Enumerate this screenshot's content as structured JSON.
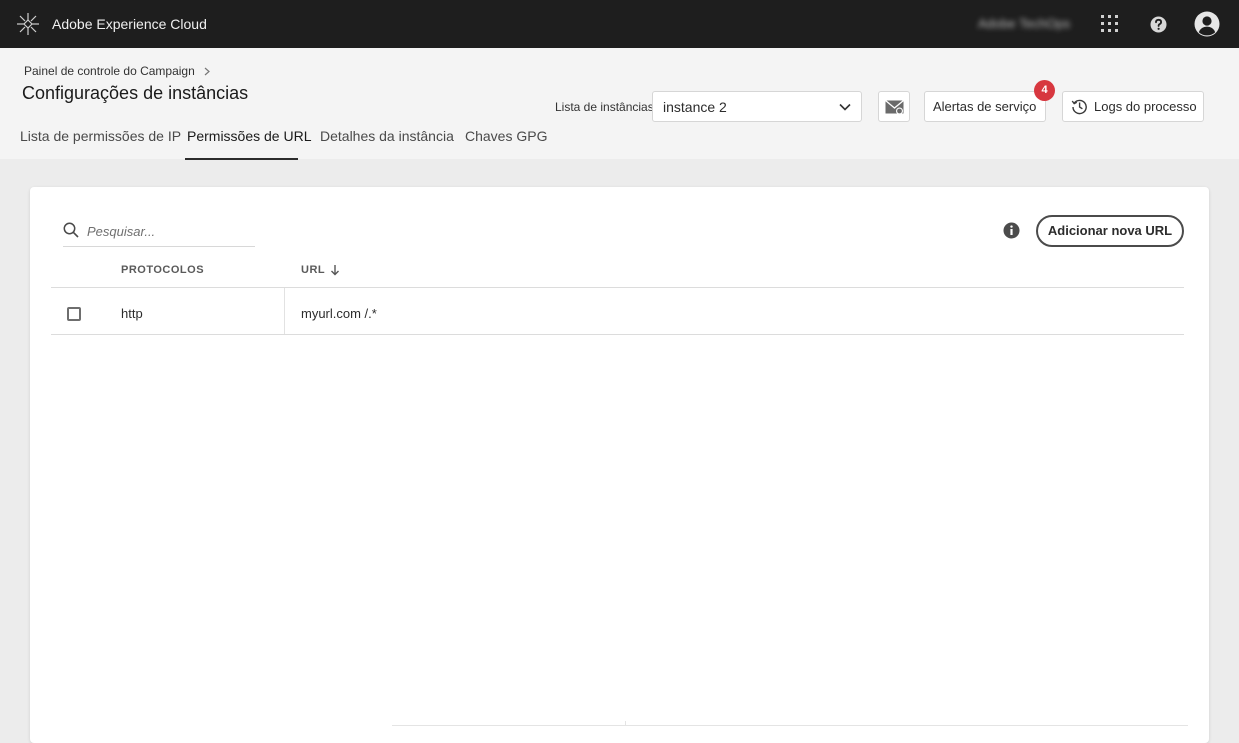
{
  "topbar": {
    "app_title": "Adobe Experience Cloud",
    "org_name": "Adobe TechOps",
    "icons": [
      "adobe-logo-icon",
      "apps-grid-icon",
      "help-icon",
      "profile-icon"
    ]
  },
  "header": {
    "breadcrumb": "Painel de controle do Campaign",
    "title": "Configurações de instâncias",
    "instance_label": "Lista de instâncias",
    "instance_selected": "instance 2",
    "alerts_label": "Alertas de serviço",
    "alerts_count": "4",
    "logs_label": "Logs do processo"
  },
  "tabs": [
    {
      "label": "Lista de permissões de IP",
      "active": false
    },
    {
      "label": "Permissões de URL",
      "active": true
    },
    {
      "label": "Detalhes da instância",
      "active": false
    },
    {
      "label": "Chaves GPG",
      "active": false
    }
  ],
  "toolbar": {
    "search_placeholder": "Pesquisar...",
    "add_label": "Adicionar nova URL"
  },
  "table": {
    "columns": [
      "PROTOCOLOS",
      "URL"
    ],
    "sort_column": "URL",
    "rows": [
      {
        "protocol": "http",
        "url": "myurl.com /.*"
      }
    ]
  },
  "colors": {
    "topbar_bg": "#1e1e1e",
    "badge": "#d7373f",
    "header_bg": "#f4f4f4",
    "page_bg": "#ececec"
  }
}
